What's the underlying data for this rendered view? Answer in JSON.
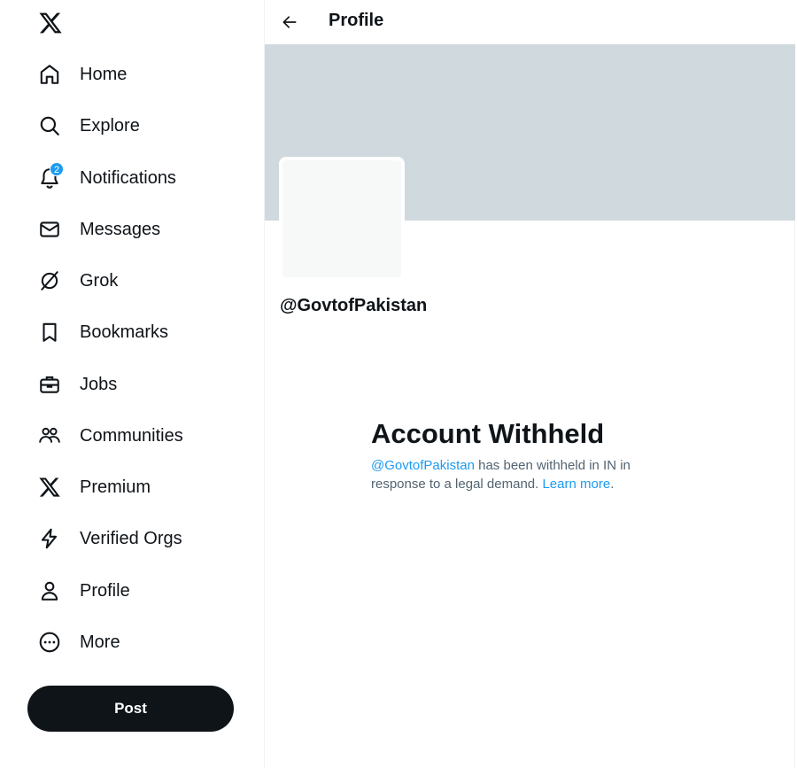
{
  "sidebar": {
    "items": [
      {
        "label": "Home",
        "icon": "home-icon"
      },
      {
        "label": "Explore",
        "icon": "search-icon"
      },
      {
        "label": "Notifications",
        "icon": "bell-icon",
        "badge": "2"
      },
      {
        "label": "Messages",
        "icon": "envelope-icon"
      },
      {
        "label": "Grok",
        "icon": "grok-icon"
      },
      {
        "label": "Bookmarks",
        "icon": "bookmark-icon"
      },
      {
        "label": "Jobs",
        "icon": "briefcase-icon"
      },
      {
        "label": "Communities",
        "icon": "people-icon"
      },
      {
        "label": "Premium",
        "icon": "x-logo-icon"
      },
      {
        "label": "Verified Orgs",
        "icon": "lightning-icon"
      },
      {
        "label": "Profile",
        "icon": "person-icon"
      },
      {
        "label": "More",
        "icon": "more-circle-icon"
      }
    ],
    "post_label": "Post"
  },
  "header": {
    "title": "Profile"
  },
  "profile": {
    "handle": "@GovtofPakistan"
  },
  "withheld": {
    "title": "Account Withheld",
    "handle_link": "@GovtofPakistan",
    "text_part1": " has been withheld in IN in response to a legal demand. ",
    "learn_more": "Learn more",
    "period": "."
  },
  "colors": {
    "accent": "#1d9bf0",
    "text": "#0f1419",
    "secondary_text": "#536471",
    "banner": "#cfd9de",
    "post_button": "#0f1419"
  }
}
